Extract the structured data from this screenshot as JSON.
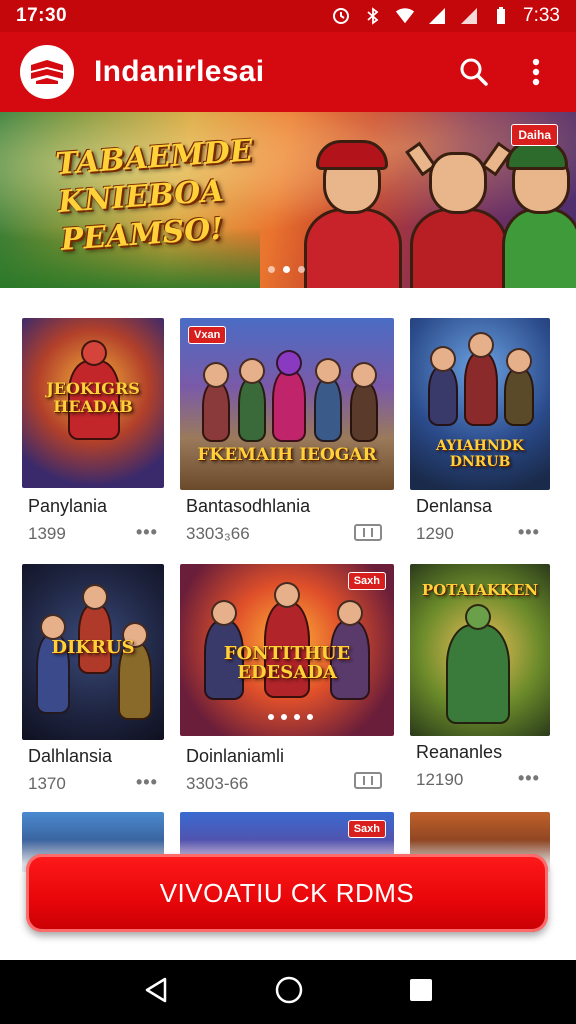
{
  "status_bar": {
    "time": "17:30",
    "time_right": "7:33"
  },
  "app_bar": {
    "title": "Indanirlesai"
  },
  "banner": {
    "title_lines": [
      "TABAEMDE",
      "KNIEBOA",
      "PEAMSO!"
    ],
    "badge": "Daiha"
  },
  "games": [
    {
      "name": "Panylania",
      "meta": "1399",
      "thumb_text": "JEOKIGRS HEADAB"
    },
    {
      "name": "Bantasodhlania",
      "meta": "3303₃66",
      "thumb_text": "FKEMAIH IEOGAR",
      "badge": "Vxan"
    },
    {
      "name": "Denlansa",
      "meta": "1290",
      "thumb_text": "AYIAHNDK DNRUB"
    },
    {
      "name": "Dalhlansia",
      "meta": "1370",
      "thumb_text": "DIKRUS"
    },
    {
      "name": "Doinlaniamli",
      "meta": "3303-66",
      "thumb_text": "FONTITHUE EDESADA",
      "badge": "Saxh"
    },
    {
      "name": "Reananles",
      "meta": "12190",
      "thumb_text": "POTAIAKKEN"
    }
  ],
  "partial_row": {
    "badge": "Saxh"
  },
  "cta": {
    "label": "VIVOATIU CK RDMS"
  },
  "colors": {
    "primary": "#d50a10",
    "status": "#c4070b",
    "cta": "#e8060a"
  }
}
